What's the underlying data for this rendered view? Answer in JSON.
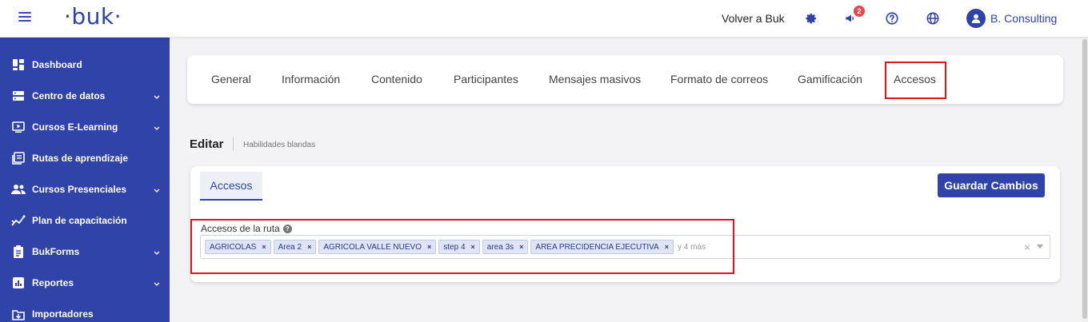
{
  "header": {
    "logo": "·buk·",
    "back_link": "Volver a Buk",
    "notification_count": "2",
    "user_name": "B. Consulting"
  },
  "sidebar": {
    "items": [
      {
        "label": "Dashboard",
        "icon": "dashboard-icon",
        "expandable": false
      },
      {
        "label": "Centro de datos",
        "icon": "server-icon",
        "expandable": true
      },
      {
        "label": "Cursos E-Learning",
        "icon": "monitor-play-icon",
        "expandable": true
      },
      {
        "label": "Rutas de aprendizaje",
        "icon": "book-icon",
        "expandable": false
      },
      {
        "label": "Cursos Presenciales",
        "icon": "users-icon",
        "expandable": true
      },
      {
        "label": "Plan de capacitación",
        "icon": "chart-line-icon",
        "expandable": false
      },
      {
        "label": "BukForms",
        "icon": "clipboard-icon",
        "expandable": true
      },
      {
        "label": "Reportes",
        "icon": "bar-chart-icon",
        "expandable": true
      },
      {
        "label": "Importadores",
        "icon": "import-icon",
        "expandable": false
      }
    ]
  },
  "tabs": [
    "General",
    "Información",
    "Contenido",
    "Participantes",
    "Mensajes masivos",
    "Formato de correos",
    "Gamificación",
    "Accesos"
  ],
  "active_tab": "Accesos",
  "edit": {
    "title": "Editar",
    "subtitle": "Habilidades blandas"
  },
  "card": {
    "inner_tab": "Accesos",
    "save_label": "Guardar Cambios",
    "field_label": "Accesos de la ruta",
    "chips": [
      "AGRICOLAS",
      "Area 2",
      "AGRICOLA VALLE NUEVO",
      "step 4",
      "area 3s",
      "AREA PRECIDENCIA EJECUTIVA"
    ],
    "more_text": "y 4 más"
  },
  "colors": {
    "brand": "#2f43a8",
    "highlight": "#e0141b",
    "badge": "#e5484d"
  }
}
